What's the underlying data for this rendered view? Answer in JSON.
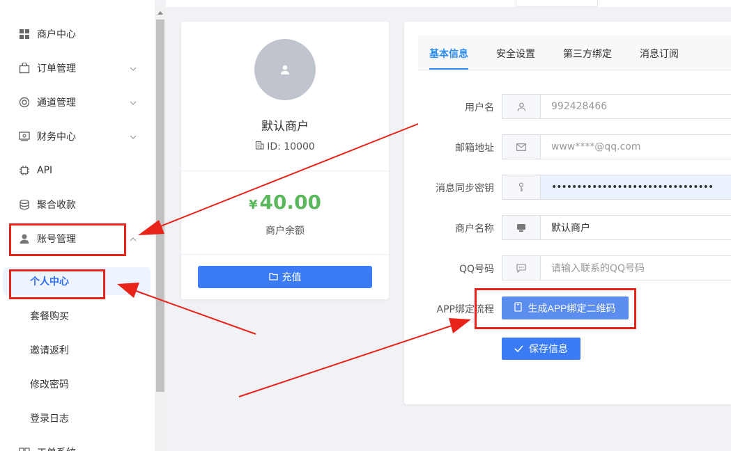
{
  "sidebar": {
    "items": [
      {
        "label": "商户中心",
        "icon": "grid-icon"
      },
      {
        "label": "订单管理",
        "icon": "bag-icon"
      },
      {
        "label": "通道管理",
        "icon": "ring-icon"
      },
      {
        "label": "财务中心",
        "icon": "wallet-icon"
      },
      {
        "label": "API",
        "icon": "chip-icon"
      },
      {
        "label": "聚合收款",
        "icon": "cash-icon"
      },
      {
        "label": "账号管理",
        "icon": "user-icon"
      }
    ],
    "sub_items": [
      {
        "label": "个人中心"
      },
      {
        "label": "套餐购买"
      },
      {
        "label": "邀请返利"
      },
      {
        "label": "修改密码"
      },
      {
        "label": "登录日志"
      }
    ],
    "partial_item": "工单系统"
  },
  "profile": {
    "name": "默认商户",
    "id_text": "ID: 10000",
    "currency": "¥",
    "balance": "40.00",
    "balance_label": "商户余额",
    "recharge_label": "充值"
  },
  "tabs": [
    {
      "label": "基本信息"
    },
    {
      "label": "安全设置"
    },
    {
      "label": "第三方绑定"
    },
    {
      "label": "消息订阅"
    }
  ],
  "form": {
    "username": {
      "label": "用户名",
      "value": "992428466"
    },
    "email": {
      "label": "邮箱地址",
      "value": "www****@qq.com"
    },
    "sync_key": {
      "label": "消息同步密钥",
      "value": "••••••••••••••••••••••••••••••••"
    },
    "merchant_name": {
      "label": "商户名称",
      "value": "默认商户"
    },
    "qq": {
      "label": "QQ号码",
      "placeholder": "请输入联系的QQ号码"
    },
    "app_bind": {
      "label": "APP绑定流程",
      "button": "生成APP绑定二维码"
    },
    "save_button": "保存信息"
  },
  "colors": {
    "primary": "#3b7cf4",
    "tab_active": "#2d8cf0",
    "balance": "#5cb85c",
    "annotation": "#e8231a"
  }
}
